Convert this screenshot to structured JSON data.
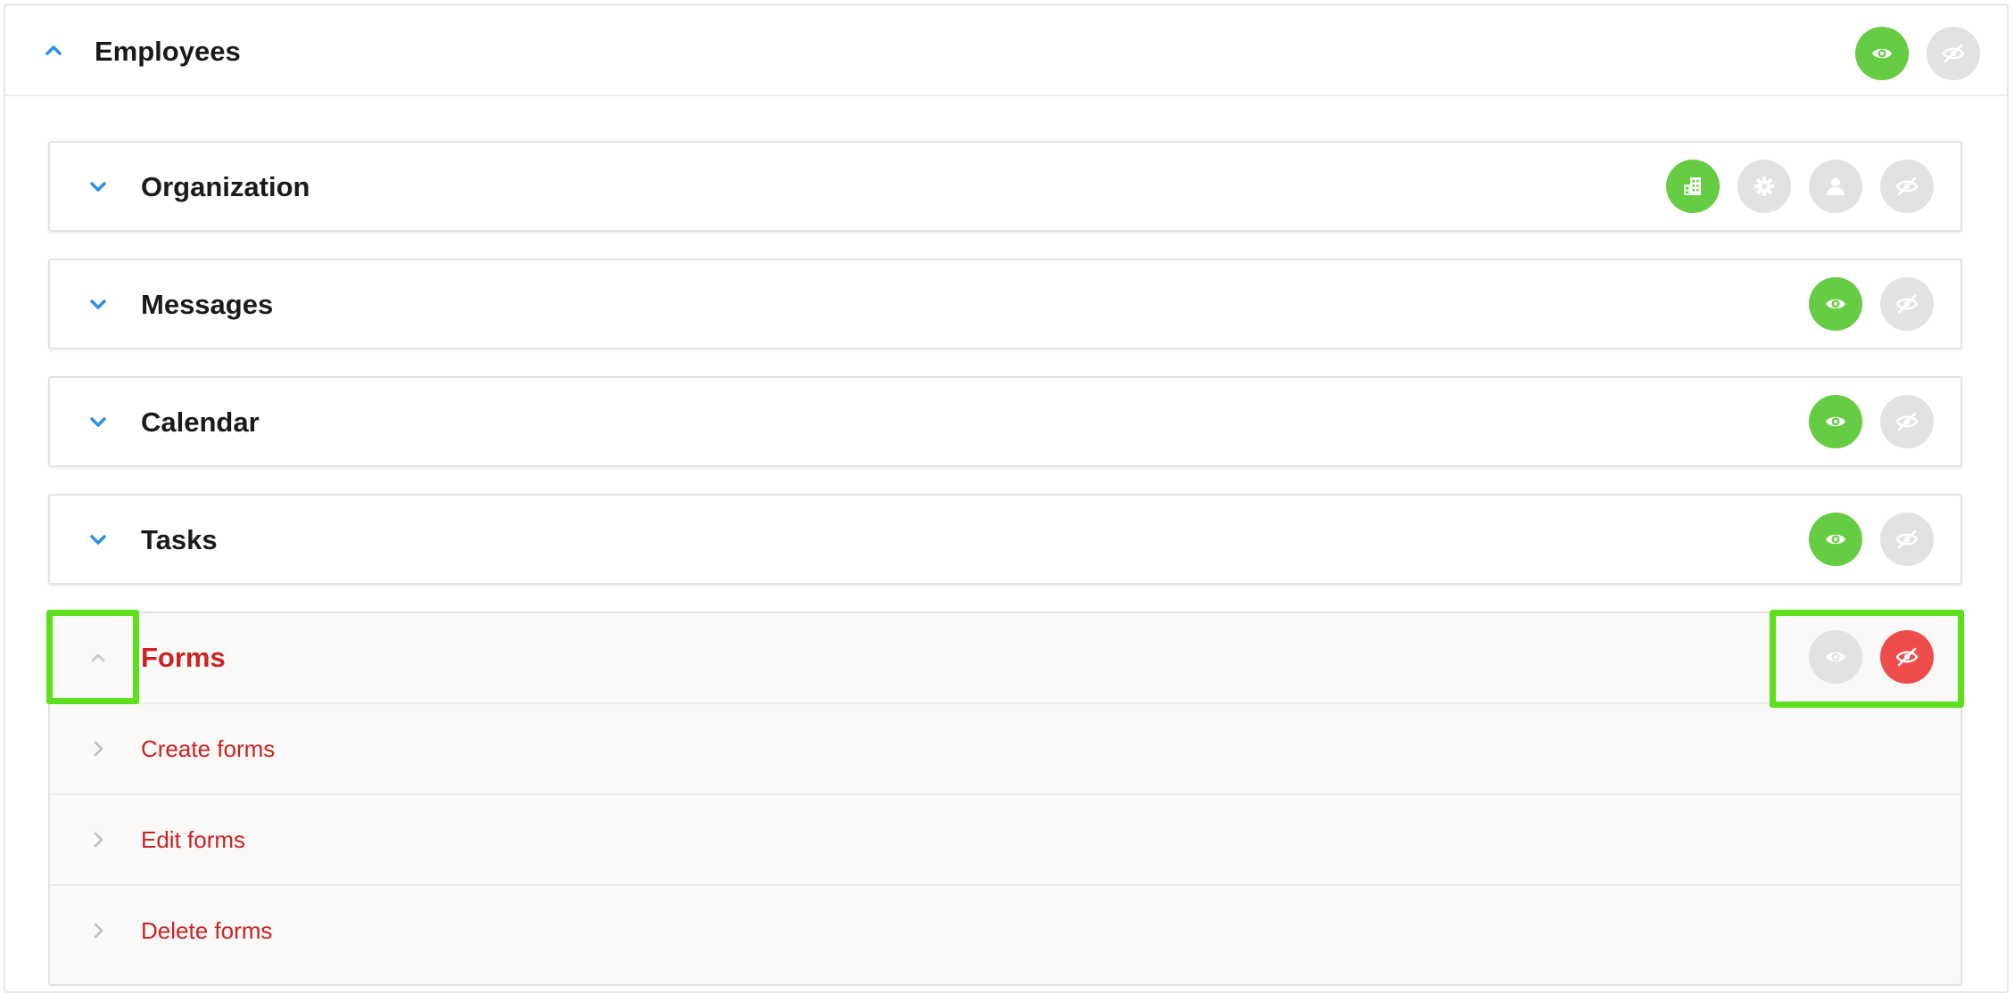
{
  "employees": {
    "title": "Employees",
    "actions": [
      {
        "icon": "eye-icon",
        "state": "active",
        "color": "#66cc44"
      },
      {
        "icon": "eye-off-icon",
        "state": "inactive",
        "color": "#e2e2e2"
      }
    ]
  },
  "sections": [
    {
      "title": "Organization",
      "actions": [
        {
          "icon": "building-icon",
          "state": "active"
        },
        {
          "icon": "gear-icon",
          "state": "inactive"
        },
        {
          "icon": "user-icon",
          "state": "inactive"
        },
        {
          "icon": "eye-off-icon",
          "state": "inactive"
        }
      ]
    },
    {
      "title": "Messages",
      "actions": [
        {
          "icon": "eye-icon",
          "state": "active"
        },
        {
          "icon": "eye-off-icon",
          "state": "inactive"
        }
      ]
    },
    {
      "title": "Calendar",
      "actions": [
        {
          "icon": "eye-icon",
          "state": "active"
        },
        {
          "icon": "eye-off-icon",
          "state": "inactive"
        }
      ]
    },
    {
      "title": "Tasks",
      "actions": [
        {
          "icon": "eye-icon",
          "state": "active"
        },
        {
          "icon": "eye-off-icon",
          "state": "inactive"
        }
      ]
    }
  ],
  "forms": {
    "title": "Forms",
    "actions": [
      {
        "icon": "eye-icon",
        "state": "inactive"
      },
      {
        "icon": "eye-off-icon",
        "state": "denied",
        "color": "#ee4b4b"
      }
    ],
    "items": [
      {
        "label": "Create forms"
      },
      {
        "label": "Edit forms"
      },
      {
        "label": "Delete forms"
      }
    ]
  },
  "colors": {
    "accent_blue": "#2b8fe8",
    "active_green": "#66cc44",
    "inactive_grey": "#e2e2e2",
    "denied_red": "#ee4b4b",
    "denied_text": "#cc2222",
    "highlight_green": "#5ce01e"
  }
}
